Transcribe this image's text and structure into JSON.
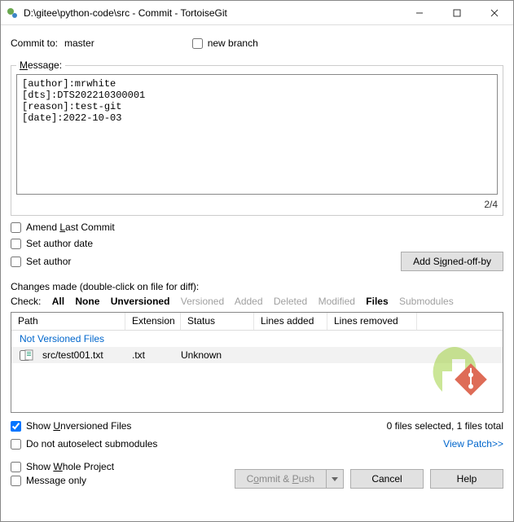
{
  "titlebar": {
    "title": "D:\\gitee\\python-code\\src - Commit - TortoiseGit"
  },
  "header": {
    "commit_to_label": "Commit to:",
    "branch": "master",
    "new_branch_label": "new branch"
  },
  "message": {
    "legend": "Message:",
    "text": "[author]:mrwhite\n[dts]:DTS202210300001\n[reason]:test-git\n[date]:2022-10-03",
    "counter": "2/4"
  },
  "options": {
    "amend_last_commit": "Amend Last Commit",
    "set_author_date": "Set author date",
    "set_author": "Set author",
    "add_signed_off": "Add Signed-off-by"
  },
  "changes": {
    "title": "Changes made (double-click on file for diff):",
    "check_label": "Check:",
    "filters": {
      "all": "All",
      "none": "None",
      "unversioned": "Unversioned",
      "versioned": "Versioned",
      "added": "Added",
      "deleted": "Deleted",
      "modified": "Modified",
      "files": "Files",
      "submodules": "Submodules"
    },
    "columns": {
      "path": "Path",
      "ext": "Extension",
      "status": "Status",
      "lines_added": "Lines added",
      "lines_removed": "Lines removed"
    },
    "section": "Not Versioned Files",
    "rows": [
      {
        "path": "src/test001.txt",
        "ext": ".txt",
        "status": "Unknown",
        "lines_added": "",
        "lines_removed": ""
      }
    ],
    "summary": "0 files selected, 1 files total"
  },
  "lower": {
    "show_unversioned": "Show Unversioned Files",
    "do_not_autoselect": "Do not autoselect submodules",
    "view_patch": "View Patch>>",
    "show_whole_project": "Show Whole Project",
    "message_only": "Message only"
  },
  "buttons": {
    "commit_push": "Commit & Push",
    "cancel": "Cancel",
    "help": "Help"
  }
}
